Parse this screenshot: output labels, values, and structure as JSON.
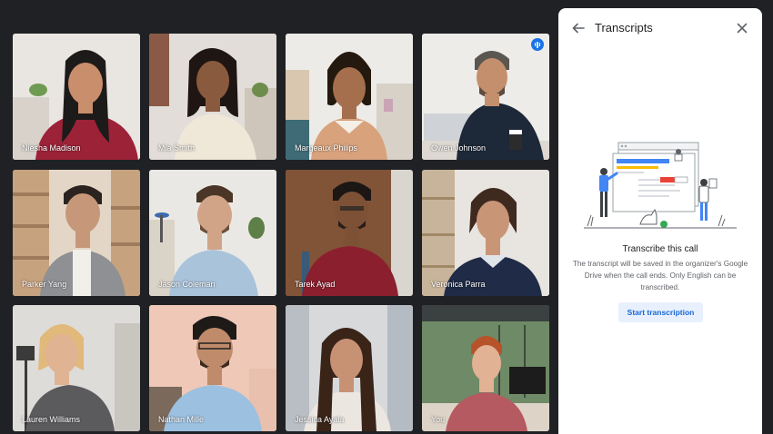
{
  "participants": [
    {
      "name": "Niesha Madison"
    },
    {
      "name": "Mia Smith"
    },
    {
      "name": "Margeaux Philips"
    },
    {
      "name": "Owen Johnson"
    },
    {
      "name": "Parker Yang"
    },
    {
      "name": "Jason Coleman"
    },
    {
      "name": "Tarek Ayad"
    },
    {
      "name": "Veronica Parra"
    },
    {
      "name": "Lauren Williams"
    },
    {
      "name": "Nathan Mille"
    },
    {
      "name": "Jessica Ayala"
    },
    {
      "name": "You"
    }
  ],
  "active_speaker_index": 3,
  "panel": {
    "title": "Transcripts",
    "back_icon": "arrow-back-icon",
    "close_icon": "close-icon",
    "empty_title": "Transcribe this call",
    "empty_body": "The transcript will be saved in the organizer's Google Drive when the call ends. Only English can be transcribed.",
    "start_button": "Start transcription"
  },
  "colors": {
    "background": "#202124",
    "panel": "#ffffff",
    "accent": "#1a73e8",
    "button_bg": "#e8f0fe",
    "button_text": "#1967d2"
  }
}
